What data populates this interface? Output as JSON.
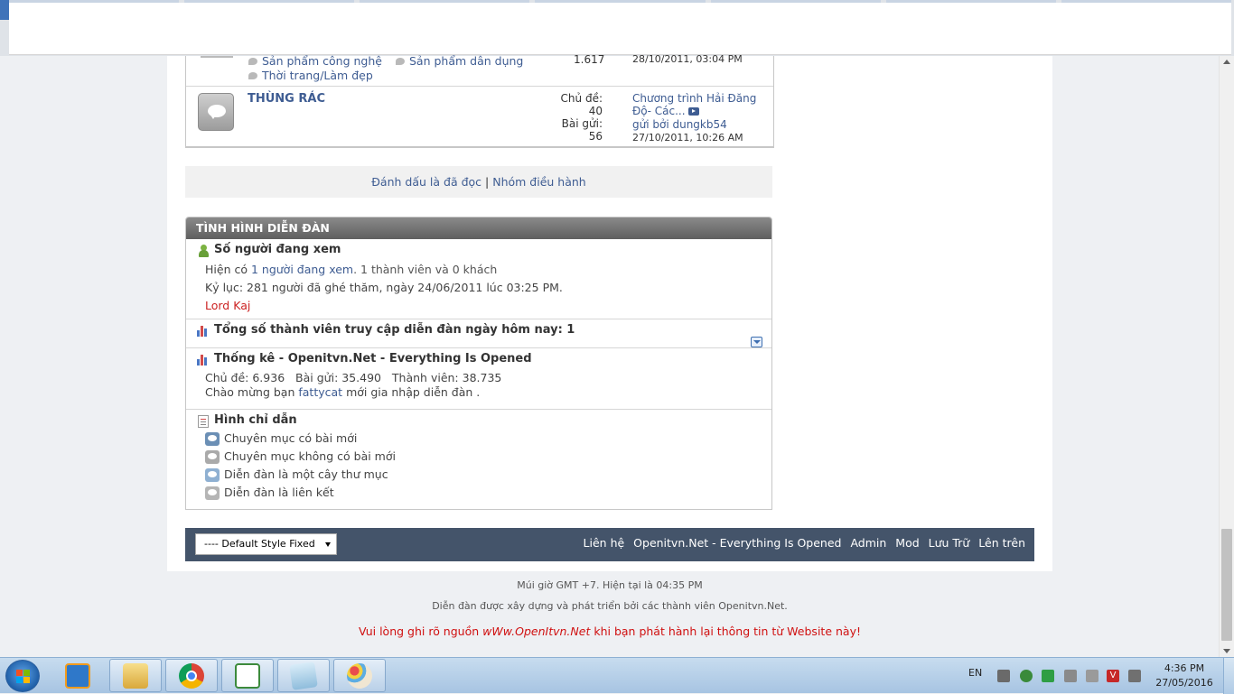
{
  "forum_top": {
    "subforums": [
      "Sản phẩm công nghệ",
      "Sản phẩm dân dụng",
      "Thời trang/Làm đẹp"
    ],
    "posts_count": "1.617",
    "last_post_date": "28/10/2011, 03:04 PM"
  },
  "trash_forum": {
    "title": "THÙNG RÁC",
    "threads_label": "Chủ đề:",
    "threads_value": "40",
    "posts_label": "Bài gửi:",
    "posts_value": "56",
    "last_thread_title": "Chương trình Hải Đăng Độ- Các...",
    "last_by": "gửi bởi dungkb54",
    "last_date": "27/10/2011, 10:26 AM"
  },
  "mark_bar": {
    "mark_read": "Đánh dấu là đã đọc",
    "separator": "|",
    "moderators": "Nhóm điều hành"
  },
  "status_panel": {
    "header": "TÌNH HÌNH DIỄN ĐÀN",
    "viewers": {
      "title": "Số người đang xem",
      "line_prefix": "Hiện có",
      "line_link": "1 người đang xem",
      "line_suffix": ". 1 thành viên và 0 khách",
      "record": "Kỷ lục: 281 người đã ghé thăm, ngày 24/06/2011 lúc 03:25 PM.",
      "user": "Lord Kaj"
    },
    "today": {
      "title": "Tổng số thành viên truy cập diễn đàn ngày hôm nay: 1"
    },
    "stats": {
      "title": "Thống kê - Openitvn.Net - Everything Is Opened",
      "line": "Chủ đề: 6.936   Bài gửi: 35.490   Thành viên: 38.735",
      "welcome_prefix": "Chào mừng bạn",
      "welcome_user": "fattycat",
      "welcome_suffix": "mới gia nhập diễn đàn ."
    },
    "legend": {
      "title": "Hình chỉ dẫn",
      "items": [
        "Chuyên mục có bài mới",
        "Chuyên mục không có bài mới",
        "Diễn đàn là một cây thư mục",
        "Diễn đàn là liên kết"
      ]
    }
  },
  "footer": {
    "style_select": "---- Default Style Fixed",
    "links": [
      "Liên hệ",
      "Openitvn.Net - Everything Is Opened",
      "Admin",
      "Mod",
      "Lưu Trữ",
      "Lên trên"
    ],
    "timezone": "Múi giờ GMT +7. Hiện tại là 04:35 PM",
    "built_by": "Diễn đàn được xây dựng và phát triển bởi các thành viên Openitvn.Net.",
    "notice_prefix": "Vui lòng ghi rõ nguồn",
    "notice_site": "wWw.OpenItvn.Net",
    "notice_suffix": "khi bạn phát hành lại thông tin từ Website này!"
  },
  "taskbar": {
    "lang": "EN",
    "time": "4:36 PM",
    "date": "27/05/2016"
  },
  "colors": {
    "link": "#3e5c92",
    "footer_bar": "#44546a",
    "notice_red": "#d01010",
    "username_red": "#cc2222"
  }
}
